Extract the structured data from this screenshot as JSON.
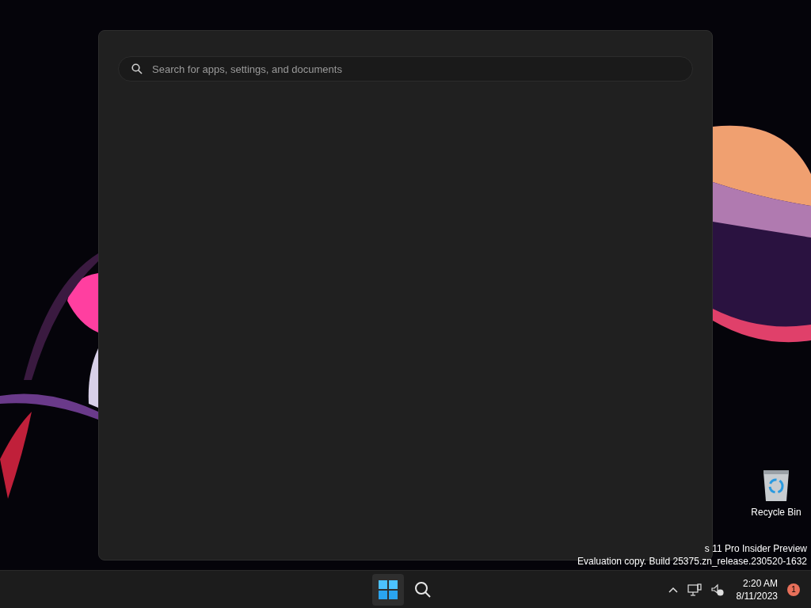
{
  "start_menu": {
    "search": {
      "placeholder": "Search for apps, settings, and documents"
    }
  },
  "desktop_icons": [
    {
      "label": "Recycle Bin"
    }
  ],
  "watermark_lines": [
    "s 11 Pro Insider Preview",
    "Evaluation copy. Build 25375.zn_release.230520-1632"
  ],
  "taskbar": {
    "start_selected": true,
    "clock": {
      "time": "2:20 AM",
      "date": "8/11/2023"
    },
    "notification_count": "1"
  }
}
